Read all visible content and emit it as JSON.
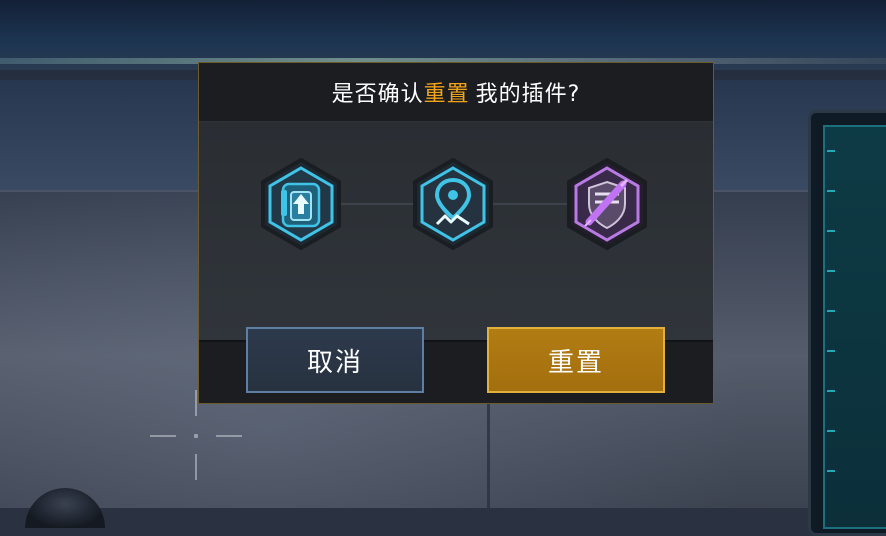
{
  "dialog": {
    "title_prefix": "是否确认",
    "title_highlight": "重置",
    "title_suffix": "我的插件?",
    "cancel_label": "取消",
    "reset_label": "重置"
  },
  "plugins": [
    {
      "icon": "backpack-upgrade-icon",
      "color": "#3fc4e8"
    },
    {
      "icon": "location-pin-landing-icon",
      "color": "#3fc4e8"
    },
    {
      "icon": "shield-syringe-icon",
      "color": "#b77be3"
    }
  ],
  "colors": {
    "accent": "#f0a21c",
    "reset_button": "#a87311",
    "cancel_button": "#27323f",
    "blue_plugin": "#3fc4e8",
    "purple_plugin": "#b77be3"
  }
}
